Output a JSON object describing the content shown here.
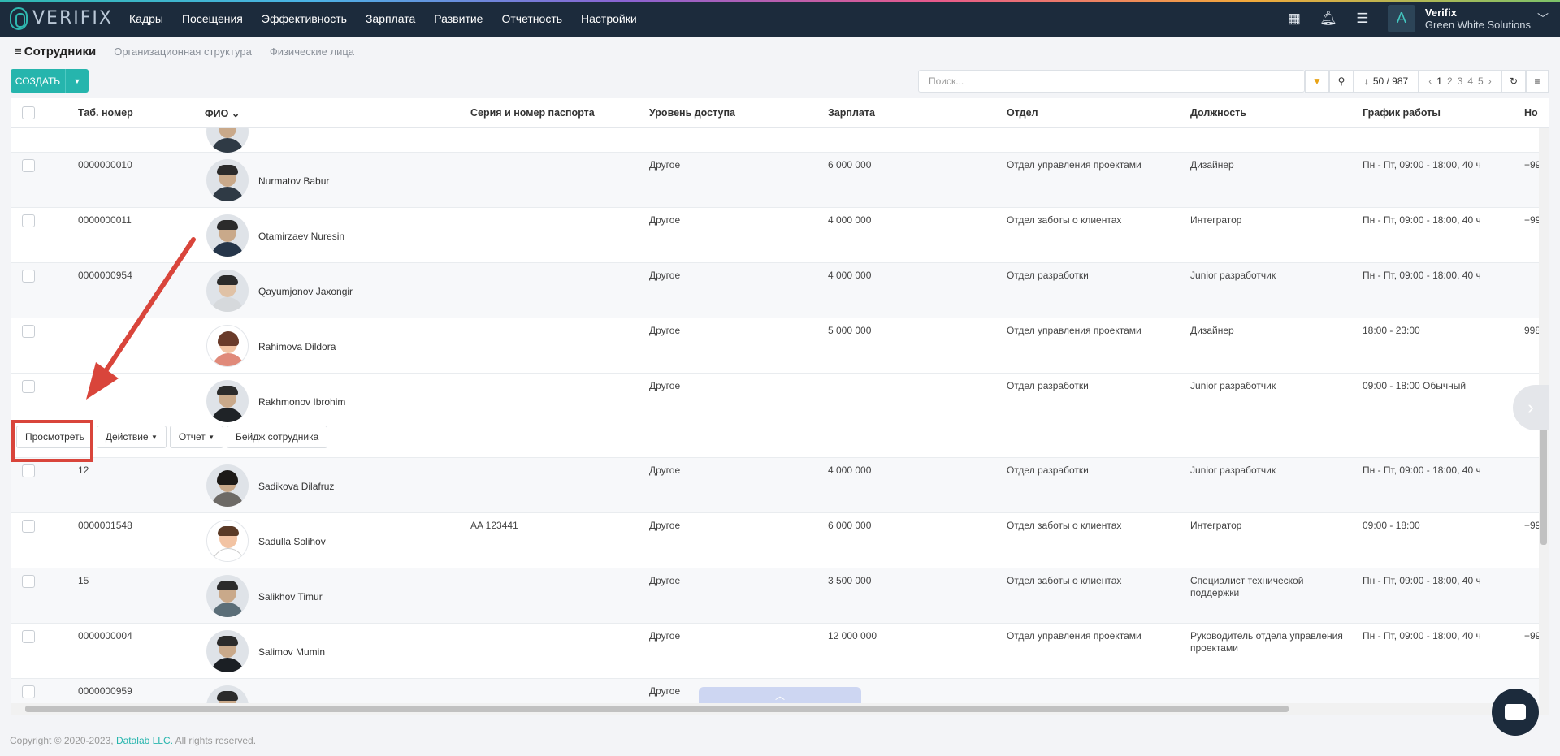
{
  "app": {
    "logo_text": "VERIFIX",
    "user_initial": "A",
    "company_name": "Verifix",
    "company_sub": "Green White Solutions"
  },
  "nav": [
    "Кадры",
    "Посещения",
    "Эффективность",
    "Зарплата",
    "Развитие",
    "Отчетность",
    "Настройки"
  ],
  "subheader": {
    "title": "Сотрудники",
    "links": [
      "Организационная структура",
      "Физические лица"
    ]
  },
  "toolbar": {
    "create_label": "СОЗДАТЬ",
    "search_placeholder": "Поиск...",
    "count": "50 / 987",
    "pages": [
      "1",
      "2",
      "3",
      "4",
      "5"
    ]
  },
  "columns": [
    "Таб. номер",
    "ФИО",
    "Серия и номер паспорта",
    "Уровень доступа",
    "Зарплата",
    "Отдел",
    "Должность",
    "График работы",
    "Но"
  ],
  "rows": [
    {
      "tab": "0000000010",
      "fio": "Nurmatov Babur",
      "passport": "",
      "access": "Другое",
      "salary": "6 000 000",
      "dept": "Отдел управления проектами",
      "position": "Дизайнер",
      "schedule": "Пн - Пт, 09:00 - 18:00, 40 ч",
      "phone": "+99"
    },
    {
      "tab": "0000000011",
      "fio": "Otamirzaev Nuresin",
      "passport": "",
      "access": "Другое",
      "salary": "4 000 000",
      "dept": "Отдел заботы о клиентах",
      "position": "Интегратор",
      "schedule": "Пн - Пт, 09:00 - 18:00, 40 ч",
      "phone": "+99"
    },
    {
      "tab": "0000000954",
      "fio": "Qayumjonov Jaxongir",
      "passport": "",
      "access": "Другое",
      "salary": "4 000 000",
      "dept": "Отдел разработки",
      "position": "Junior разработчик",
      "schedule": "Пн - Пт, 09:00 - 18:00, 40 ч",
      "phone": ""
    },
    {
      "tab": "",
      "fio": "Rahimova Dildora",
      "passport": "",
      "access": "Другое",
      "salary": "5 000 000",
      "dept": "Отдел управления проектами",
      "position": "Дизайнер",
      "schedule": "18:00 - 23:00",
      "phone": "998"
    },
    {
      "tab": "",
      "fio": "Rakhmonov Ibrohim",
      "passport": "",
      "access": "Другое",
      "salary": "",
      "dept": "Отдел разработки",
      "position": "Junior разработчик",
      "schedule": "09:00 - 18:00 Обычный",
      "phone": ""
    },
    {
      "tab": "12",
      "fio": "Sadikova Dilafruz",
      "passport": "",
      "access": "Другое",
      "salary": "4 000 000",
      "dept": "Отдел разработки",
      "position": "Junior разработчик",
      "schedule": "Пн - Пт, 09:00 - 18:00, 40 ч",
      "phone": ""
    },
    {
      "tab": "0000001548",
      "fio": "Sadulla Solihov",
      "passport": "AA 123441",
      "access": "Другое",
      "salary": "6 000 000",
      "dept": "Отдел заботы о клиентах",
      "position": "Интегратор",
      "schedule": "09:00 - 18:00",
      "phone": "+99"
    },
    {
      "tab": "15",
      "fio": "Salikhov Timur",
      "passport": "",
      "access": "Другое",
      "salary": "3 500 000",
      "dept": "Отдел заботы о клиентах",
      "position": "Специалист технической поддержки",
      "schedule": "Пн - Пт, 09:00 - 18:00, 40 ч",
      "phone": ""
    },
    {
      "tab": "0000000004",
      "fio": "Salimov Mumin",
      "passport": "",
      "access": "Другое",
      "salary": "12 000 000",
      "dept": "Отдел управления проектами",
      "position": "Руководитель отдела управления проектами",
      "schedule": "Пн - Пт, 09:00 - 18:00, 40 ч",
      "phone": "+99"
    },
    {
      "tab": "0000000959",
      "fio": "",
      "passport": "",
      "access": "Другое",
      "salary": "",
      "dept": "",
      "position": "",
      "schedule": "",
      "phone": ""
    }
  ],
  "row_actions": {
    "view": "Просмотреть",
    "action": "Действие",
    "report": "Отчет",
    "badge": "Бейдж сотрудника"
  },
  "footer": {
    "copyright": "Copyright © 2020-2023,",
    "brand": "Datalab LLC.",
    "rights": "All rights reserved."
  }
}
